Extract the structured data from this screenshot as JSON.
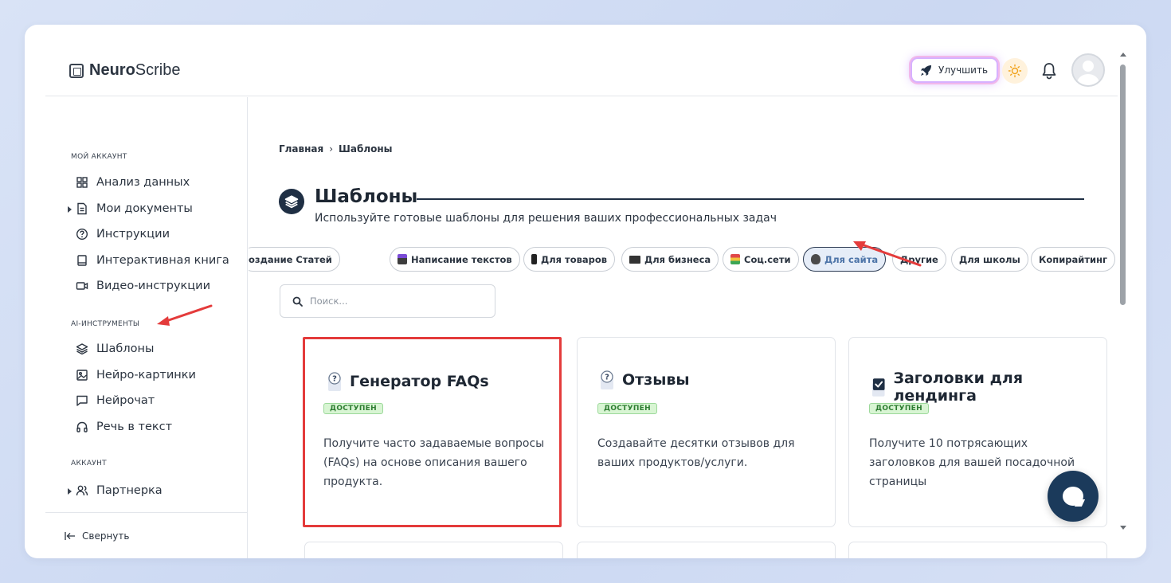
{
  "app": {
    "logo_bold": "Neuro",
    "logo_rest": "Scribe"
  },
  "header": {
    "upgrade_label": "Улучшить"
  },
  "sidebar": {
    "sections": [
      {
        "title": "МОЙ АККАУНТ"
      },
      {
        "title": "AI-ИНСТРУМЕНТЫ"
      },
      {
        "title": "АККАУНТ"
      }
    ],
    "items": [
      {
        "label": "Анализ данных",
        "icon": "grid-icon"
      },
      {
        "label": "Мои документы",
        "icon": "document-icon"
      },
      {
        "label": "Инструкции",
        "icon": "question-circle-icon"
      },
      {
        "label": "Интерактивная книга",
        "icon": "book-icon"
      },
      {
        "label": "Видео-инструкции",
        "icon": "video-icon"
      },
      {
        "label": "Шаблоны",
        "icon": "layers-icon"
      },
      {
        "label": "Нейро-картинки",
        "icon": "image-icon"
      },
      {
        "label": "Нейрочат",
        "icon": "chat-icon"
      },
      {
        "label": "Речь в текст",
        "icon": "headphones-icon"
      },
      {
        "label": "Партнерка",
        "icon": "users-icon"
      }
    ],
    "collapse_label": "Свернуть"
  },
  "breadcrumb": {
    "home": "Главная",
    "separator": "›",
    "current": "Шаблоны"
  },
  "page": {
    "title": "Шаблоны",
    "subtitle": "Используйте готовые шаблоны для решения ваших профессиональных задач"
  },
  "chips": [
    {
      "label": "оздание Статей",
      "icon": ""
    },
    {
      "label": "Написание текстов",
      "icon": "building-icon"
    },
    {
      "label": "Для товаров",
      "icon": "phone-icon"
    },
    {
      "label": "Для бизнеса",
      "icon": "laptop-icon"
    },
    {
      "label": "Соц.сети",
      "icon": "notebook-icon"
    },
    {
      "label": "Для сайта",
      "icon": "mask-icon",
      "active": true
    },
    {
      "label": "Другие",
      "icon": ""
    },
    {
      "label": "Для школы",
      "icon": ""
    },
    {
      "label": "Копирайтинг",
      "icon": ""
    }
  ],
  "search": {
    "placeholder": "Поиск..."
  },
  "cards": [
    {
      "title": "Генератор FAQs",
      "badge": "ДОСТУПЕН",
      "description": "Получите часто задаваемые вопросы (FAQs) на основе описания вашего продукта.",
      "icon": "faq-icon"
    },
    {
      "title": "Отзывы",
      "badge": "ДОСТУПЕН",
      "description": "Создавайте десятки отзывов для ваших продуктов/услуги.",
      "icon": "faq-icon"
    },
    {
      "title": "Заголовки для лендинга",
      "badge": "ДОСТУПЕН",
      "description": "Получите 10 потрясающих заголовков для вашей посадочной страницы",
      "icon": "checkbox-icon"
    }
  ],
  "colors": {
    "accent_dark": "#1f2f44",
    "highlight_red": "#e43b3b",
    "badge_green": "#d8f5d3",
    "chip_active": "#4d74a8"
  }
}
